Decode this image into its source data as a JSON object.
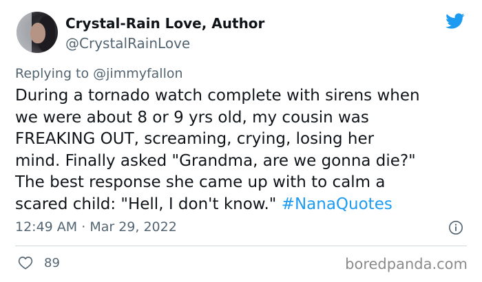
{
  "author": {
    "display_name": "Crystal-Rain Love, Author",
    "handle": "@CrystalRainLove"
  },
  "reply": {
    "prefix": "Replying to ",
    "to": "@jimmyfallon"
  },
  "tweet": {
    "lines": [
      "During a tornado watch complete with sirens when",
      "we were about 8 or 9 yrs old, my cousin was",
      "FREAKING OUT, screaming, crying, losing her",
      "mind. Finally asked \"Grandma, are we gonna die?\"",
      "The best response she came up with to calm a",
      "scared child: \"Hell, I don't know.\" "
    ],
    "hashtag": "#NanaQuotes",
    "time": "12:49 AM",
    "separator": " · ",
    "date": "Mar 29, 2022",
    "likes": "89"
  },
  "icons": {
    "brand": "twitter-bird-icon",
    "info": "info-icon",
    "like": "heart-icon"
  },
  "colors": {
    "accent": "#1d9bf0",
    "secondary_text": "#536471",
    "text": "#0f1419"
  },
  "watermark": "boredpanda.com"
}
